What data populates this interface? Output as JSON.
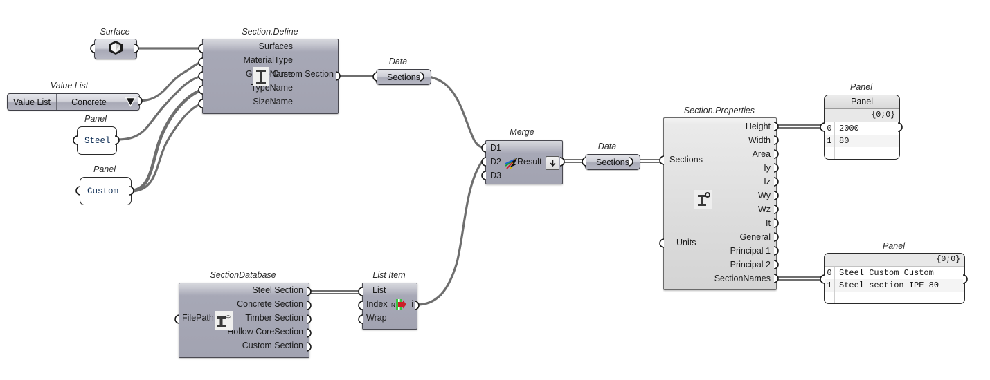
{
  "canvas": {
    "background": "#ffffff",
    "wire_color": "#6e6e6e"
  },
  "nodes": {
    "surface": {
      "caption": "Surface",
      "icon": "surface-icon"
    },
    "section_define": {
      "caption": "Section.Define",
      "inputs": [
        "Surfaces",
        "MaterialType",
        "GroupName",
        "TypeName",
        "SizeName"
      ],
      "outputs": [
        "Custom Section"
      ],
      "icon": "i-beam-icon"
    },
    "value_list": {
      "caption": "Value List",
      "name_label": "Value List",
      "selected": "Concrete",
      "arrow_icon": "chevron-down-icon"
    },
    "panel_steel": {
      "caption": "Panel",
      "text": "Steel"
    },
    "panel_custom": {
      "caption": "Panel",
      "text": "Custom"
    },
    "data_sections_left": {
      "caption": "Data",
      "label": "Sections"
    },
    "merge": {
      "caption": "Merge",
      "inputs": [
        "D1",
        "D2",
        "D3"
      ],
      "outputs": [
        "Result"
      ],
      "icon": "merge-arrows-icon",
      "button_icon": "arrow-down-icon"
    },
    "data_sections_right": {
      "caption": "Data",
      "label": "Sections"
    },
    "section_properties": {
      "caption": "Section.Properties",
      "inputs": [
        "Sections",
        "Units"
      ],
      "outputs": [
        "Height",
        "Width",
        "Area",
        "Iy",
        "Iz",
        "Wy",
        "Wz",
        "It",
        "General",
        "Principal 1",
        "Principal 2",
        "SectionNames"
      ],
      "icon": "i-beam-props-icon"
    },
    "section_database": {
      "caption": "SectionDatabase",
      "inputs": [
        "FilePath"
      ],
      "outputs": [
        "Steel Section",
        "Concrete Section",
        "Timber Section",
        "Hollow CoreSection",
        "Custom Section"
      ],
      "icon": "i-beam-db-icon"
    },
    "list_item": {
      "caption": "List Item",
      "inputs": [
        "List",
        "Index",
        "Wrap"
      ],
      "outputs": [
        "i"
      ],
      "icon": "list-item-icon"
    },
    "panel_top_right": {
      "caption": "Panel",
      "title": "Panel",
      "path": "{0;0}",
      "rows": [
        {
          "index": "0",
          "value": "2000"
        },
        {
          "index": "1",
          "value": "80"
        }
      ]
    },
    "panel_bottom_right": {
      "caption": "Panel",
      "path": "{0;0}",
      "rows": [
        {
          "index": "0",
          "value": "Steel Custom Custom"
        },
        {
          "index": "1",
          "value": "Steel section IPE 80"
        }
      ]
    }
  }
}
